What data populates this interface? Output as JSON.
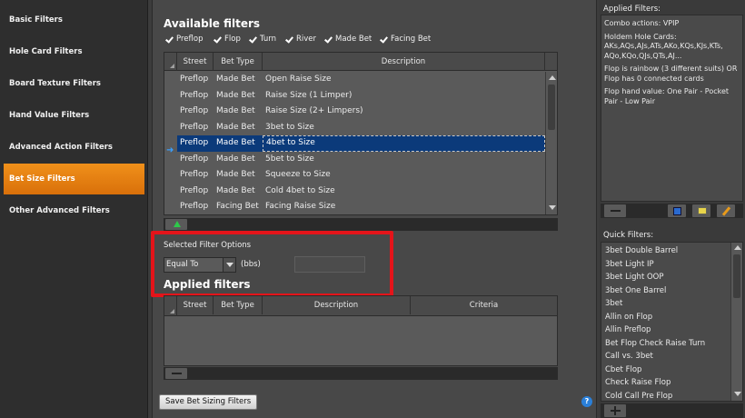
{
  "nav": {
    "items": [
      {
        "label": "Basic Filters"
      },
      {
        "label": "Hole Card Filters"
      },
      {
        "label": "Board Texture Filters"
      },
      {
        "label": "Hand Value Filters"
      },
      {
        "label": "Advanced Action Filters"
      },
      {
        "label": "Bet Size Filters",
        "active": true
      },
      {
        "label": "Other Advanced Filters"
      }
    ]
  },
  "available": {
    "title": "Available filters",
    "streets": [
      "Preflop",
      "Flop",
      "Turn",
      "River",
      "Made Bet",
      "Facing Bet"
    ],
    "columns": [
      "Street",
      "Bet Type",
      "Description"
    ],
    "rows": [
      [
        "Preflop",
        "Made Bet",
        "Open Raise Size"
      ],
      [
        "Preflop",
        "Made Bet",
        "Raise Size (1 Limper)"
      ],
      [
        "Preflop",
        "Made Bet",
        "Raise Size (2+ Limpers)"
      ],
      [
        "Preflop",
        "Made Bet",
        "3bet to Size"
      ],
      [
        "Preflop",
        "Made Bet",
        "4bet to Size"
      ],
      [
        "Preflop",
        "Made Bet",
        "5bet to Size"
      ],
      [
        "Preflop",
        "Made Bet",
        "Squeeze to Size"
      ],
      [
        "Preflop",
        "Made Bet",
        "Cold 4bet to Size"
      ],
      [
        "Preflop",
        "Facing Bet",
        "Facing Raise Size"
      ]
    ],
    "selected_index": 4
  },
  "options": {
    "title": "Selected Filter Options",
    "operator": "Equal To",
    "unit": "(bbs)",
    "value": ""
  },
  "applied": {
    "title": "Applied filters",
    "columns": [
      "Street",
      "Bet Type",
      "Description",
      "Criteria"
    ]
  },
  "save_button": "Save Bet Sizing Filters",
  "help": "?",
  "right": {
    "applied_title": "Applied Filters:",
    "applied_items": [
      "Combo actions: VPIP",
      "Holdem Hole Cards: AKs,AQs,AJs,ATs,AKo,KQs,KJs,KTs, AQo,KQo,QJs,QTs,AJ...",
      "Flop is rainbow (3 different suits) OR Flop has 0 connected cards",
      "Flop hand value: One Pair - Pocket Pair - Low Pair"
    ],
    "quick_title": "Quick Filters:",
    "quick_items": [
      "3bet Double Barrel",
      "3bet Light IP",
      "3bet Light OOP",
      "3bet One Barrel",
      "3bet",
      "Allin on Flop",
      "Allin Preflop",
      "Bet Flop Check Raise Turn",
      "Call vs. 3bet",
      "Cbet Flop",
      "Check Raise Flop",
      "Cold Call Pre Flop"
    ]
  },
  "colors": {
    "accent": "#e8820e",
    "selection": "#0b3a7a",
    "highlight_box": "#e4141a"
  }
}
